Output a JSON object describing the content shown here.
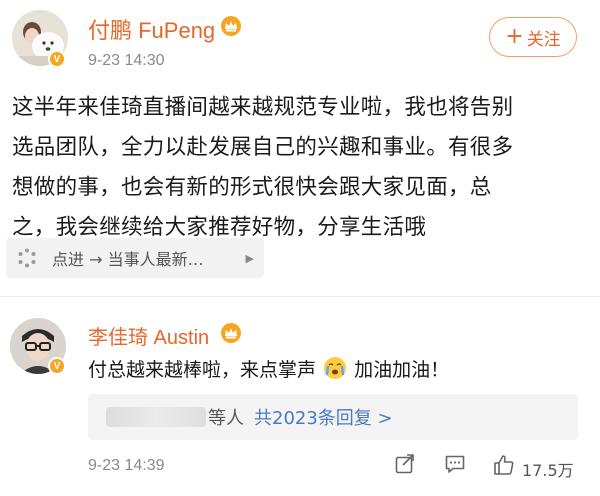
{
  "post": {
    "author": {
      "name": "付鹏 FuPeng",
      "verified_icon": "orange-v-badge",
      "fan_icon": "orange-crown-badge"
    },
    "time": "9-23 14:30",
    "follow_label": "关注",
    "content_lines": [
      "这半年来佳琦直播间越来越规范专业啦，我也将告别",
      "选品团队，全力以赴发展自己的兴趣和事业。有很多",
      "想做的事，也会有新的形式很快会跟大家见面，总",
      "之，我会继续给大家推荐好物，分享生活哦"
    ],
    "link_card": {
      "icon": "spinner-icon",
      "text": "点进 → 当事人最新…"
    }
  },
  "comment": {
    "author": {
      "name": "李佳琦 Austin",
      "verified_icon": "orange-v-badge",
      "fan_icon": "orange-crown-badge"
    },
    "text_before_emoji": "付总越来越棒啦，来点掌声",
    "emoji": "crying-face-emoji",
    "text_after_emoji": "加油加油！",
    "replies": {
      "people_suffix": "等人",
      "total_label": "共2023条回复 >"
    },
    "time": "9-23 14:39",
    "like_count": "17.5万"
  },
  "colors": {
    "name_orange": "#e8662a",
    "link_blue": "#4a79c4",
    "muted_gray": "#8a8a8a",
    "badge_orange": "#f5a623"
  }
}
